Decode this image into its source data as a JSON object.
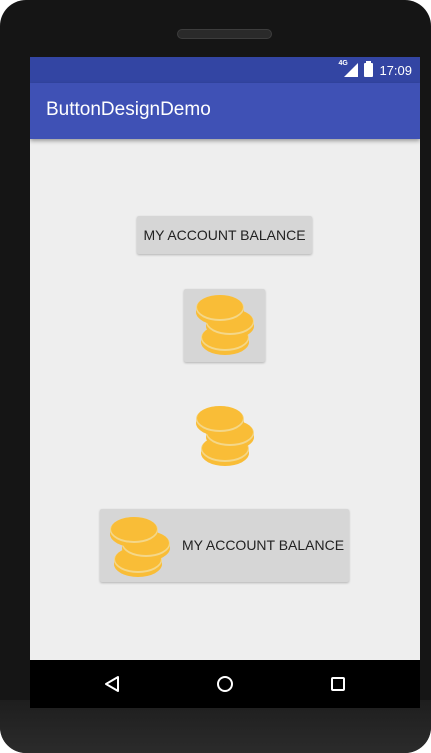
{
  "status_bar": {
    "network_label": "4G",
    "time": "17:09",
    "icons": [
      "signal-icon",
      "battery-icon"
    ]
  },
  "app_bar": {
    "title": "ButtonDesignDemo"
  },
  "buttons": {
    "text_button_label": "MY ACCOUNT BALANCE",
    "image_button_icon": "coins-icon",
    "plain_image_icon": "coins-icon",
    "combo_button_label": "MY ACCOUNT BALANCE",
    "combo_button_icon": "coins-icon"
  },
  "nav_bar": {
    "icons": [
      "back-icon",
      "home-icon",
      "recents-icon"
    ]
  },
  "colors": {
    "status_bar": "#3345a3",
    "app_bar": "#3f51b5",
    "screen_background": "#eeeeee",
    "button_background": "#d6d6d6",
    "coin_gold": "#f9bd37"
  }
}
